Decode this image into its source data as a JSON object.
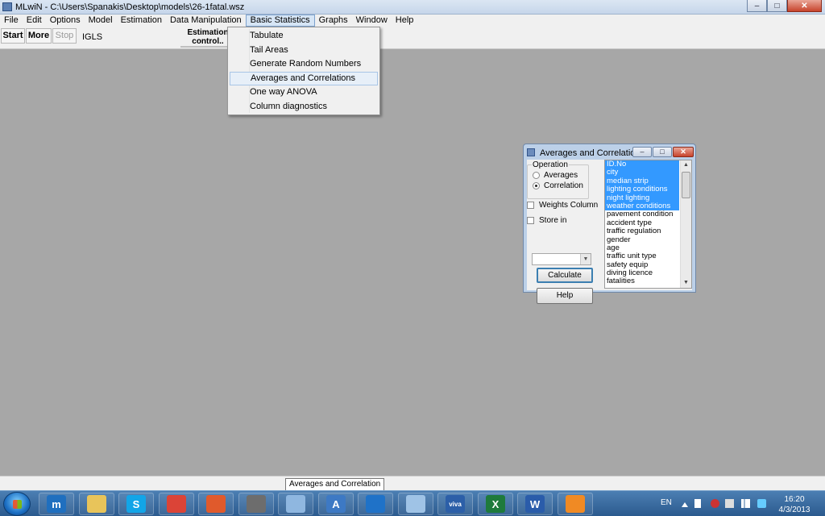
{
  "window": {
    "title": "MLwiN - C:\\Users\\Spanakis\\Desktop\\models\\26-1fatal.wsz",
    "min_glyph": "–",
    "max_glyph": "□",
    "close_glyph": "✕"
  },
  "menubar": {
    "items": [
      "File",
      "Edit",
      "Options",
      "Model",
      "Estimation",
      "Data Manipulation",
      "Basic Statistics",
      "Graphs",
      "Window",
      "Help"
    ],
    "active_index": 6
  },
  "toolbar": {
    "start_label": "Start",
    "more_label": "More",
    "stop_label": "Stop",
    "method_label": "IGLS",
    "estimation_line1": "Estimation",
    "estimation_line2": "control.."
  },
  "dropdown": {
    "items": [
      "Tabulate",
      "Tail Areas",
      "Generate Random Numbers",
      "Averages and Correlations",
      "One way ANOVA",
      "Column diagnostics"
    ],
    "highlighted_index": 3
  },
  "dialog": {
    "title": "Averages and Correlation",
    "operation_label": "Operation",
    "radio_averages": "Averages",
    "radio_correlation": "Correlation",
    "selected_operation": "Correlation",
    "weights_label": "Weights Column",
    "store_label": "Store in",
    "calculate_label": "Calculate",
    "help_label": "Help",
    "variables": [
      {
        "name": "ID.No",
        "selected": true
      },
      {
        "name": "city",
        "selected": true
      },
      {
        "name": "median strip",
        "selected": true
      },
      {
        "name": "lighting conditions",
        "selected": true
      },
      {
        "name": "night lighting",
        "selected": true
      },
      {
        "name": "weather conditions",
        "selected": true
      },
      {
        "name": "pavement condition",
        "selected": false
      },
      {
        "name": "accident type",
        "selected": false
      },
      {
        "name": "traffic regulation",
        "selected": false
      },
      {
        "name": "gender",
        "selected": false
      },
      {
        "name": "age",
        "selected": false
      },
      {
        "name": "traffic unit type",
        "selected": false
      },
      {
        "name": "safety equip",
        "selected": false
      },
      {
        "name": "diving licence",
        "selected": false
      },
      {
        "name": "fatalities",
        "selected": false
      }
    ]
  },
  "tooltip": {
    "text": "Averages and Correlation"
  },
  "taskbar": {
    "apps": [
      {
        "name": "maxthon-icon",
        "glyph": "m",
        "color": "#1f6fbf"
      },
      {
        "name": "explorer-icon",
        "glyph": "",
        "color": "#e8c45a"
      },
      {
        "name": "skype-icon",
        "glyph": "S",
        "color": "#12a5e8"
      },
      {
        "name": "chrome-icon",
        "glyph": "",
        "color": "#db4437"
      },
      {
        "name": "app-icon-red",
        "glyph": "",
        "color": "#e05a2c"
      },
      {
        "name": "mlwin-icon",
        "glyph": "",
        "color": "#6d6d6d"
      },
      {
        "name": "paint-icon",
        "glyph": "",
        "color": "#8fb7e0"
      },
      {
        "name": "reader-icon",
        "glyph": "A",
        "color": "#3d79c4"
      },
      {
        "name": "teamviewer-icon",
        "glyph": "",
        "color": "#1f72c8"
      },
      {
        "name": "calculator-icon",
        "glyph": "",
        "color": "#9fc3e6"
      },
      {
        "name": "viva-icon",
        "glyph": "viva",
        "color": "#2c5fa8"
      },
      {
        "name": "excel-icon",
        "glyph": "X",
        "color": "#1e7a3c"
      },
      {
        "name": "word-icon",
        "glyph": "W",
        "color": "#2a5caa"
      },
      {
        "name": "app-icon-orange",
        "glyph": "",
        "color": "#f08a24"
      }
    ],
    "language": "EN",
    "time": "16:20",
    "date": "4/3/2013"
  }
}
